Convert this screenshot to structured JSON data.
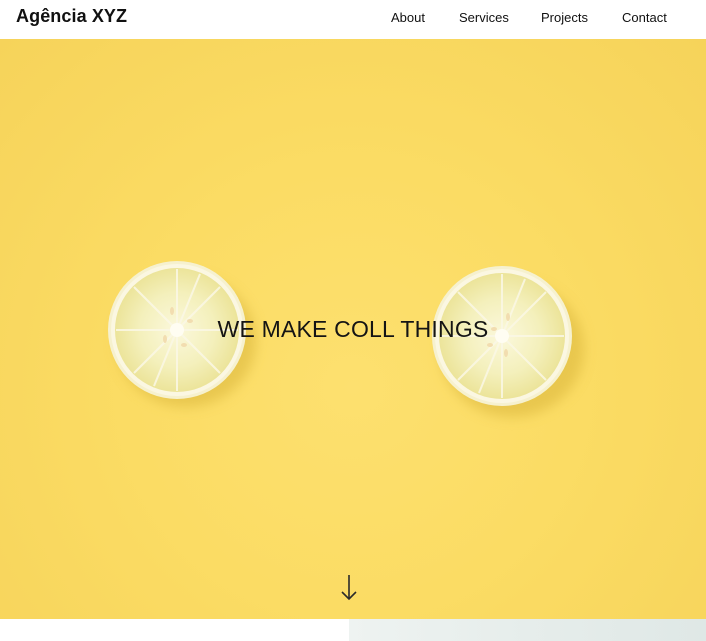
{
  "navbar": {
    "brand": "Agência XYZ",
    "links": [
      {
        "label": "About"
      },
      {
        "label": "Services"
      },
      {
        "label": "Projects"
      },
      {
        "label": "Contact"
      }
    ]
  },
  "hero": {
    "headline": "WE MAKE COLL THINGS",
    "background_color": "#fbdc64",
    "image_subject": "two lemon slices",
    "scroll_icon": "arrow-down-icon"
  },
  "colors": {
    "hero_yellow": "#fbdc64",
    "lemon_flesh": "#f3f0b8",
    "lemon_rind": "#f4eec6",
    "text": "#111111"
  }
}
